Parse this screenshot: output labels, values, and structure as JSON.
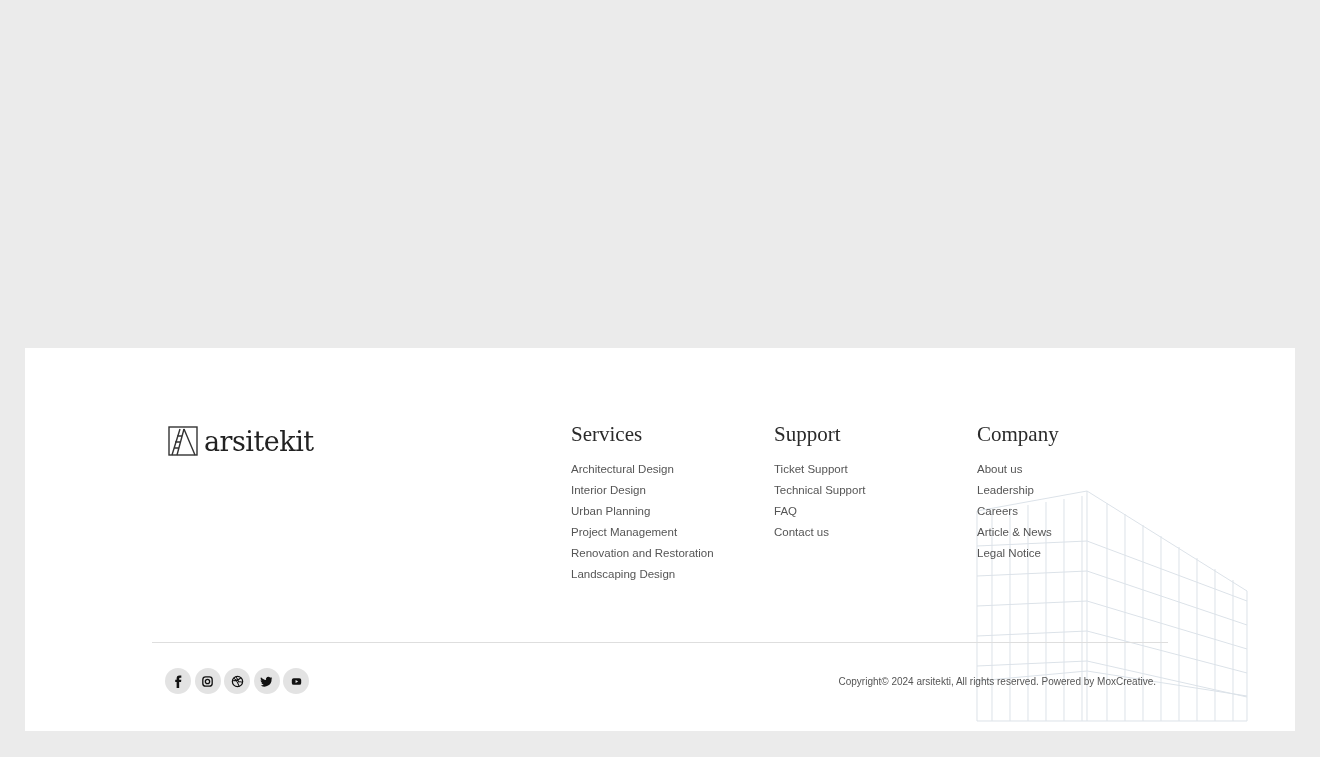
{
  "footer": {
    "logo": {
      "text": "arsitekit"
    },
    "columns": [
      {
        "heading": "Services",
        "links": [
          "Architectural Design",
          "Interior Design",
          "Urban Planning",
          "Project Management",
          "Renovation and Restoration",
          "Landscaping Design"
        ]
      },
      {
        "heading": "Support",
        "links": [
          "Ticket Support",
          "Technical Support",
          "FAQ",
          "Contact us"
        ]
      },
      {
        "heading": "Company",
        "links": [
          "About us",
          "Leadership",
          "Careers",
          "Article & News",
          "Legal Notice"
        ]
      }
    ],
    "social": [
      {
        "kind": "facebook"
      },
      {
        "kind": "instagram"
      },
      {
        "kind": "dribbble"
      },
      {
        "kind": "twitter"
      },
      {
        "kind": "youtube"
      }
    ],
    "copyright": "Copyright© 2024 arsitekti, All rights reserved. Powered by MoxCreative."
  }
}
